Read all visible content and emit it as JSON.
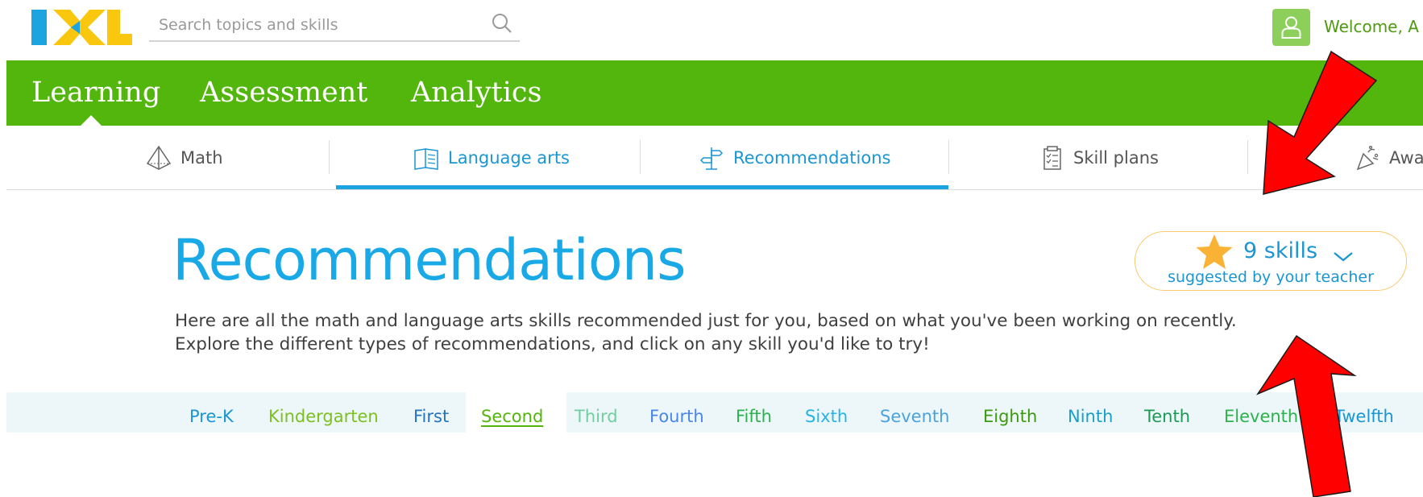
{
  "header": {
    "logo_text": "IXL",
    "search": {
      "placeholder": "Search topics and skills",
      "value": ""
    },
    "welcome_text": "Welcome, A"
  },
  "topnav": {
    "tabs": [
      {
        "label": "Learning",
        "active": true
      },
      {
        "label": "Assessment",
        "active": false
      },
      {
        "label": "Analytics",
        "active": false
      }
    ]
  },
  "subnav": {
    "items": [
      {
        "label": "Math",
        "icon": "pyramid-icon"
      },
      {
        "label": "Language arts",
        "icon": "book-icon"
      },
      {
        "label": "Recommendations",
        "icon": "signpost-icon",
        "active": true
      },
      {
        "label": "Skill plans",
        "icon": "checklist-icon"
      },
      {
        "label": "Awa",
        "icon": "party-popper-icon"
      }
    ]
  },
  "main": {
    "title": "Recommendations",
    "intro_line1": "Here are all the math and language arts skills recommended just for you, based on what you've been working on recently.",
    "intro_line2": "Explore the different types of recommendations, and click on any skill you'd like to try!",
    "skills_badge": {
      "count_label": "9 skills",
      "subtitle": "suggested by your teacher",
      "icon": "star-icon"
    }
  },
  "grades": [
    {
      "label": "Pre-K",
      "color": "#1a96d3"
    },
    {
      "label": "Kindergarten",
      "color": "#7cc021"
    },
    {
      "label": "First",
      "color": "#2374b9"
    },
    {
      "label": "Second",
      "color": "#53b60c",
      "selected": true
    },
    {
      "label": "Third",
      "color": "#6fcf9e"
    },
    {
      "label": "Fourth",
      "color": "#4a86e8"
    },
    {
      "label": "Fifth",
      "color": "#2bb24c"
    },
    {
      "label": "Sixth",
      "color": "#25b4e8"
    },
    {
      "label": "Seventh",
      "color": "#4aa3df"
    },
    {
      "label": "Eighth",
      "color": "#3d9a10"
    },
    {
      "label": "Ninth",
      "color": "#1aa0c8"
    },
    {
      "label": "Tenth",
      "color": "#1c9a55"
    },
    {
      "label": "Eleventh",
      "color": "#2bb24c"
    },
    {
      "label": "Twelfth",
      "color": "#1a96d3"
    }
  ],
  "colors": {
    "brand_green": "#53b60c",
    "brand_blue": "#18a9e6",
    "annotation_red": "#ff0000",
    "badge_border": "#f8c96a",
    "star": "#f9b233"
  }
}
